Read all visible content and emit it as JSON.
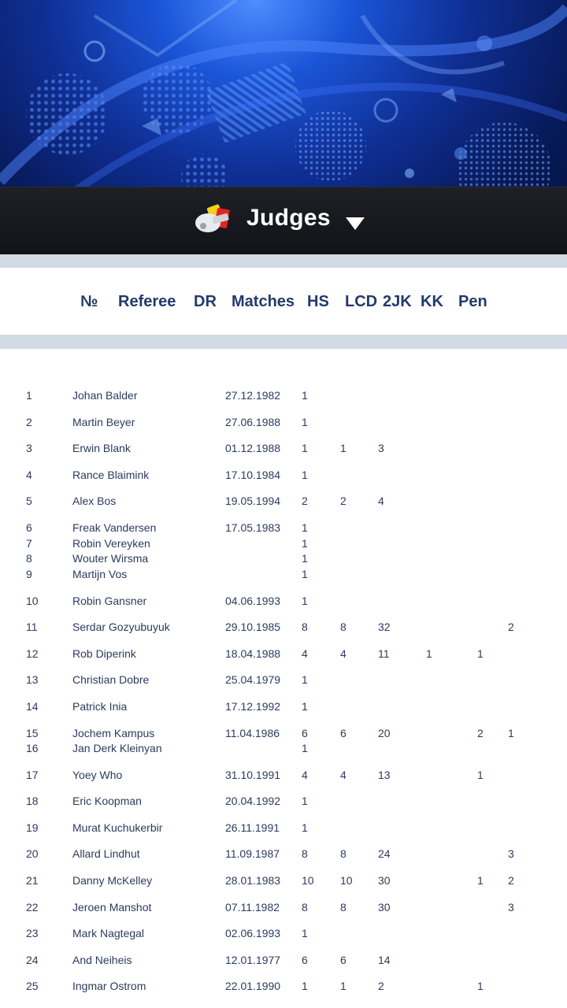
{
  "header": {
    "title": "Judges"
  },
  "columns": {
    "num": "№",
    "referee": "Referee",
    "dr": "DR",
    "matches": "Matches",
    "hs": "HS",
    "lcd": "LCD",
    "tjk": "2JK",
    "kk": "KK",
    "pen": "Pen"
  },
  "rows": [
    {
      "n": "1",
      "name": "Johan Balder",
      "dr": "27.12.1982",
      "m": "1",
      "hs": "",
      "lcd": "",
      "tjk": "",
      "kk": "",
      "pen": ""
    },
    {
      "n": "2",
      "name": "Martin Beyer",
      "dr": "27.06.1988",
      "m": "1",
      "hs": "",
      "lcd": "",
      "tjk": "",
      "kk": "",
      "pen": ""
    },
    {
      "n": "3",
      "name": "Erwin Blank",
      "dr": "01.12.1988",
      "m": "1",
      "hs": "1",
      "lcd": "3",
      "tjk": "",
      "kk": "",
      "pen": ""
    },
    {
      "n": "4",
      "name": "Rance Blaimink",
      "dr": "17.10.1984",
      "m": "1",
      "hs": "",
      "lcd": "",
      "tjk": "",
      "kk": "",
      "pen": ""
    },
    {
      "n": "5",
      "name": "Alex Bos",
      "dr": "19.05.1994",
      "m": "2",
      "hs": "2",
      "lcd": "4",
      "tjk": "",
      "kk": "",
      "pen": ""
    },
    {
      "n": "6",
      "name": "Freak Vandersen",
      "dr": "17.05.1983",
      "m": "1",
      "hs": "",
      "lcd": "",
      "tjk": "",
      "kk": "",
      "pen": ""
    },
    {
      "n": "7",
      "name": "Robin Vereyken",
      "dr": "",
      "m": "1",
      "hs": "",
      "lcd": "",
      "tjk": "",
      "kk": "",
      "pen": ""
    },
    {
      "n": "8",
      "name": "Wouter Wirsma",
      "dr": "",
      "m": "1",
      "hs": "",
      "lcd": "",
      "tjk": "",
      "kk": "",
      "pen": ""
    },
    {
      "n": "9",
      "name": "Martijn Vos",
      "dr": "",
      "m": "1",
      "hs": "",
      "lcd": "",
      "tjk": "",
      "kk": "",
      "pen": ""
    },
    {
      "n": "10",
      "name": "Robin Gansner",
      "dr": "04.06.1993",
      "m": "1",
      "hs": "",
      "lcd": "",
      "tjk": "",
      "kk": "",
      "pen": ""
    },
    {
      "n": "11",
      "name": "Serdar Gozyubuyuk",
      "dr": "29.10.1985",
      "m": "8",
      "hs": "8",
      "lcd": "32",
      "tjk": "",
      "kk": "",
      "pen": "2"
    },
    {
      "n": "12",
      "name": "Rob Diperink",
      "dr": "18.04.1988",
      "m": "4",
      "hs": "4",
      "lcd": "11",
      "tjk": "1",
      "kk": "1",
      "pen": ""
    },
    {
      "n": "13",
      "name": "Christian Dobre",
      "dr": "25.04.1979",
      "m": "1",
      "hs": "",
      "lcd": "",
      "tjk": "",
      "kk": "",
      "pen": ""
    },
    {
      "n": "14",
      "name": "Patrick Inia",
      "dr": "17.12.1992",
      "m": "1",
      "hs": "",
      "lcd": "",
      "tjk": "",
      "kk": "",
      "pen": ""
    },
    {
      "n": "15",
      "name": "Jochem Kampus",
      "dr": "11.04.1986",
      "m": "6",
      "hs": "6",
      "lcd": "20",
      "tjk": "",
      "kk": "2",
      "pen": "1"
    },
    {
      "n": "16",
      "name": "Jan Derk Kleinyan",
      "dr": "",
      "m": "1",
      "hs": "",
      "lcd": "",
      "tjk": "",
      "kk": "",
      "pen": ""
    },
    {
      "n": "17",
      "name": "Yoey Who",
      "dr": "31.10.1991",
      "m": "4",
      "hs": "4",
      "lcd": "13",
      "tjk": "",
      "kk": "1",
      "pen": ""
    },
    {
      "n": "18",
      "name": "Eric Koopman",
      "dr": "20.04.1992",
      "m": "1",
      "hs": "",
      "lcd": "",
      "tjk": "",
      "kk": "",
      "pen": ""
    },
    {
      "n": "19",
      "name": "Murat Kuchukerbir",
      "dr": "26.11.1991",
      "m": "1",
      "hs": "",
      "lcd": "",
      "tjk": "",
      "kk": "",
      "pen": ""
    },
    {
      "n": "20",
      "name": "Allard Lindhut",
      "dr": "11.09.1987",
      "m": "8",
      "hs": "8",
      "lcd": "24",
      "tjk": "",
      "kk": "",
      "pen": "3"
    },
    {
      "n": "21",
      "name": "Danny McKelley",
      "dr": "28.01.1983",
      "m": "10",
      "hs": "10",
      "lcd": "30",
      "tjk": "",
      "kk": "1",
      "pen": "2"
    },
    {
      "n": "22",
      "name": "Jeroen Manshot",
      "dr": "07.11.1982",
      "m": "8",
      "hs": "8",
      "lcd": "30",
      "tjk": "",
      "kk": "",
      "pen": "3"
    },
    {
      "n": "23",
      "name": "Mark Nagtegal",
      "dr": "02.06.1993",
      "m": "1",
      "hs": "",
      "lcd": "",
      "tjk": "",
      "kk": "",
      "pen": ""
    },
    {
      "n": "24",
      "name": "And Neiheis",
      "dr": "12.01.1977",
      "m": "6",
      "hs": "6",
      "lcd": "14",
      "tjk": "",
      "kk": "",
      "pen": ""
    },
    {
      "n": "25",
      "name": "Ingmar Ostrom",
      "dr": "22.01.1990",
      "m": "1",
      "hs": "1",
      "lcd": "2",
      "tjk": "",
      "kk": "1",
      "pen": ""
    }
  ]
}
